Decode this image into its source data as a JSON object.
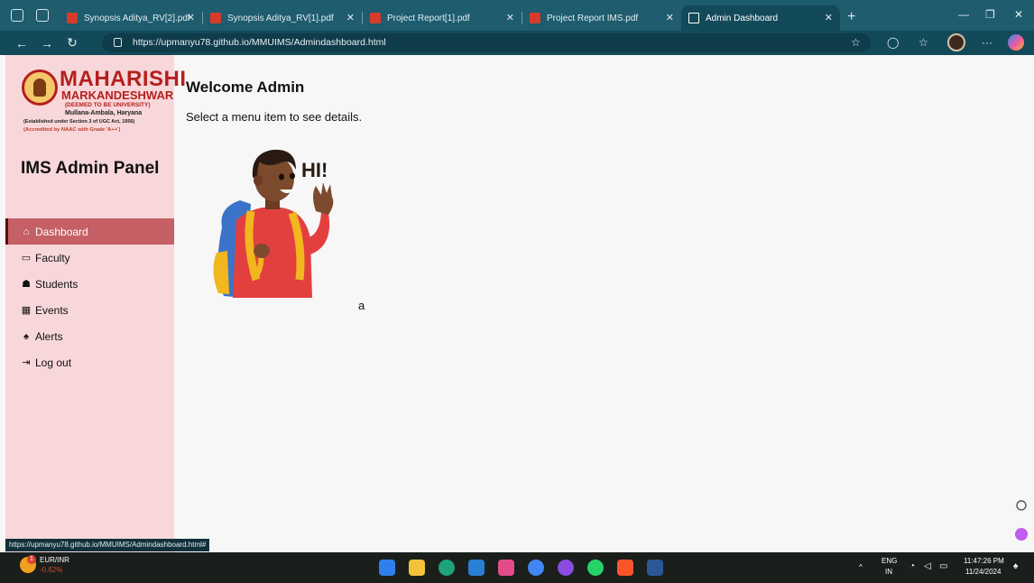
{
  "browser": {
    "tabs": [
      {
        "title": "Synopsis Aditya_RV[2].pdf",
        "active": false
      },
      {
        "title": "Synopsis Aditya_RV[1].pdf",
        "active": false
      },
      {
        "title": "Project Report[1].pdf",
        "active": false
      },
      {
        "title": "Project Report IMS.pdf",
        "active": false
      },
      {
        "title": "Admin Dashboard",
        "active": true
      }
    ],
    "url": "https://upmanyu78.github.io/MMUIMS/Admindashboard.html",
    "status_url": "https://upmanyu78.github.io/MMUIMS/Admindashboard.html#"
  },
  "logo": {
    "line1": "MAHARISHI",
    "line2": "MARKANDESHWAR",
    "line3": "(DEEMED TO BE UNIVERSITY)",
    "line4": "Mullana-Ambala, Haryana",
    "line5": "(Established under Section 3 of UGC Act, 1956)",
    "line6": "(Accredited by NAAC with Grade 'A++')"
  },
  "sidebar": {
    "title": "IMS Admin Panel",
    "items": [
      {
        "label": "Dashboard",
        "icon": "home-icon",
        "active": true
      },
      {
        "label": "Faculty",
        "icon": "chalkboard-teacher-icon",
        "active": false
      },
      {
        "label": "Students",
        "icon": "user-graduate-icon",
        "active": false
      },
      {
        "label": "Events",
        "icon": "calendar-icon",
        "active": false
      },
      {
        "label": "Alerts",
        "icon": "bell-icon",
        "active": false
      },
      {
        "label": "Log out",
        "icon": "sign-out-icon",
        "active": false
      }
    ]
  },
  "main": {
    "title": "Welcome Admin",
    "subtitle": "Select a menu item to see details.",
    "illustration_text": "HI!",
    "stray_text": "a"
  },
  "taskbar": {
    "ticker_badge": "1",
    "ticker_name": "EUR/INR",
    "ticker_change": "-0.62%",
    "lang": "ENG",
    "region": "IN",
    "time": "11:47:26 PM",
    "date": "11/24/2024"
  },
  "colors": {
    "sidebar_bg": "#f8d7da",
    "active_item": "#c46066",
    "browser_chrome": "#1e5c6e"
  }
}
